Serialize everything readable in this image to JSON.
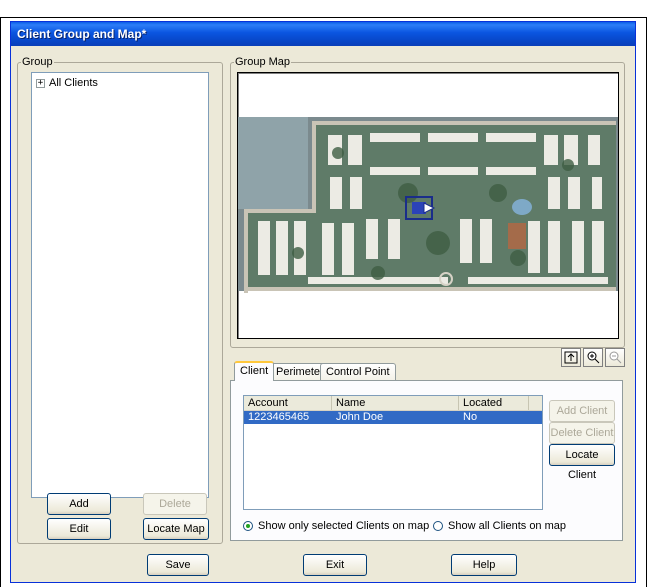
{
  "window": {
    "title": "Client Group and Map*"
  },
  "group_panel": {
    "legend": "Group",
    "tree": [
      {
        "expander": "+",
        "label": "All Clients"
      }
    ],
    "buttons": {
      "add": "Add",
      "delete": "Delete",
      "edit": "Edit",
      "locate_map": "Locate Map"
    }
  },
  "map_panel": {
    "legend": "Group Map"
  },
  "tabs": [
    {
      "label": "Client",
      "active": true
    },
    {
      "label": "Perimeter",
      "active": false
    },
    {
      "label": "Control Point",
      "active": false
    }
  ],
  "client_list": {
    "columns": [
      "Account",
      "Name",
      "Located"
    ],
    "rows": [
      {
        "account": "1223465465",
        "name": "John Doe",
        "located": "No",
        "selected": true
      }
    ]
  },
  "client_buttons": {
    "add": "Add Client",
    "delete": "Delete Client",
    "locate": "Locate Client"
  },
  "radio_options": [
    {
      "label": "Show only selected Clients on map",
      "checked": true
    },
    {
      "label": "Show all Clients on map",
      "checked": false
    }
  ],
  "map_tools": [
    "fit-to-window-icon",
    "zoom-in-icon",
    "zoom-out-icon"
  ],
  "footer_buttons": {
    "save": "Save",
    "exit": "Exit",
    "help": "Help"
  },
  "colors": {
    "titlebar": "#0a55e0",
    "selection": "#316ac5",
    "dialog_bg": "#ece9d8"
  }
}
